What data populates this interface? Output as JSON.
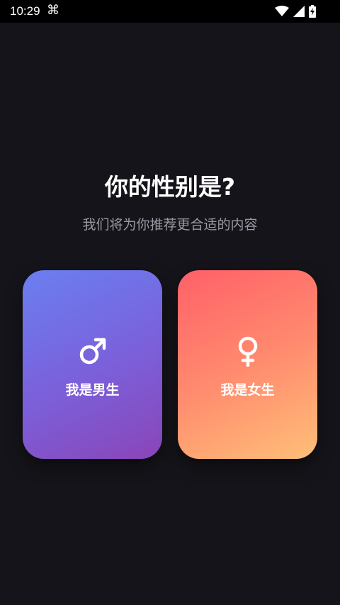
{
  "status_bar": {
    "time": "10:29",
    "notification_icon": "app-notification-icon",
    "icons": [
      "wifi-icon",
      "cellular-signal-icon",
      "battery-charging-icon"
    ]
  },
  "page": {
    "title": "你的性别是?",
    "subtitle": "我们将为你推荐更合适的内容"
  },
  "options": {
    "male": {
      "label": "我是男生",
      "icon": "male-symbol-icon",
      "gradient": [
        "#6a7ff0",
        "#8a45b8"
      ]
    },
    "female": {
      "label": "我是女生",
      "icon": "female-symbol-icon",
      "gradient": [
        "#ff6068",
        "#ffbf78"
      ]
    }
  },
  "colors": {
    "background": "#14141a",
    "subtitle": "#9a9aa6"
  }
}
